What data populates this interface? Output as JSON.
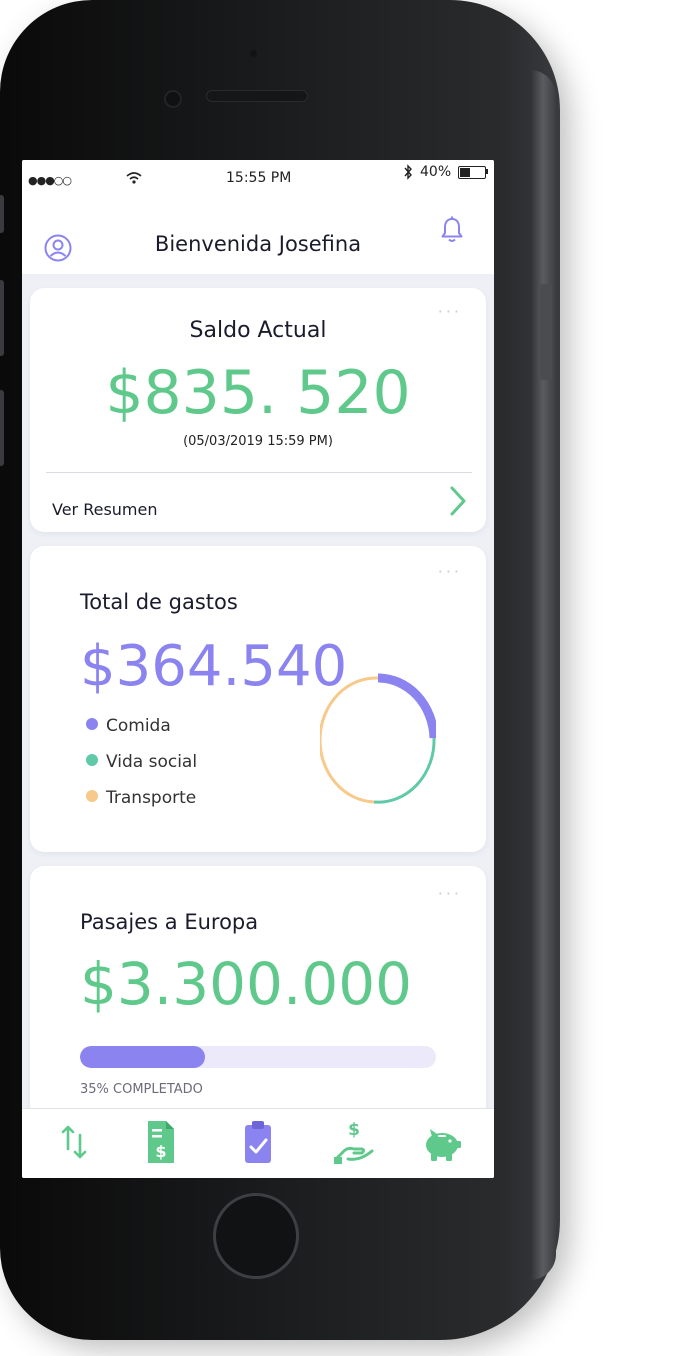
{
  "status_bar": {
    "signal": "●●●○○",
    "time": "15:55 PM",
    "battery": "40%",
    "battery_fraction": 0.4
  },
  "header": {
    "title": "Bienvenida Josefina"
  },
  "balance_card": {
    "title": "Saldo Actual",
    "amount": "$835. 520",
    "date": "(05/03/2019   15:59 PM)",
    "link_label": "Ver Resumen",
    "menu": "···"
  },
  "expenses_card": {
    "title": "Total de gastos",
    "amount": "$364.540",
    "menu": "···",
    "legend": [
      {
        "label": "Comida",
        "color": "#8b84f0"
      },
      {
        "label": "Vida social",
        "color": "#5fc9a8"
      },
      {
        "label": "Transporte",
        "color": "#f7c98a"
      }
    ]
  },
  "goal_card": {
    "title": "Pasajes a Europa",
    "amount": "$3.300.000",
    "progress": 0.35,
    "progress_label": "35% COMPLETADO",
    "menu": "···"
  },
  "colors": {
    "green": "#5fc98b",
    "purple": "#8b84f0",
    "light_purple": "#ece9fb"
  },
  "tabs": [
    {
      "icon": "transfer-arrows-icon"
    },
    {
      "icon": "invoice-dollar-icon"
    },
    {
      "icon": "clipboard-check-icon"
    },
    {
      "icon": "hand-dollar-icon"
    },
    {
      "icon": "piggy-bank-icon"
    }
  ]
}
